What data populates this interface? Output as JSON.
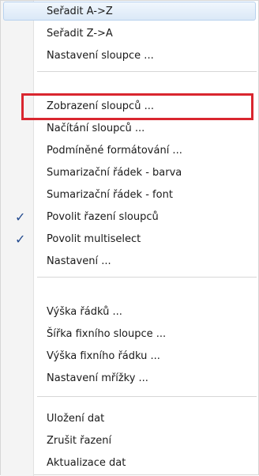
{
  "menu": {
    "items": [
      {
        "label": "Seřadit A->Z",
        "checked": false
      },
      {
        "label": "Seřadit Z->A",
        "checked": false
      },
      {
        "label": "Nastavení sloupce ...",
        "checked": false
      },
      {
        "label": "Zobrazení sloupců ...",
        "checked": false
      },
      {
        "label": "Načítání sloupců ...",
        "checked": false
      },
      {
        "label": "Podmíněné formátování ...",
        "checked": false
      },
      {
        "label": "Sumarizační řádek - barva",
        "checked": false
      },
      {
        "label": "Sumarizační řádek - font",
        "checked": false
      },
      {
        "label": "Povolit řazení sloupců",
        "checked": true
      },
      {
        "label": "Povolit multiselect",
        "checked": true
      },
      {
        "label": "Nastavení ...",
        "checked": false
      },
      {
        "label": "Výška řádků ...",
        "checked": false
      },
      {
        "label": "Šířka fixního sloupce ...",
        "checked": false
      },
      {
        "label": "Výška fixního řádku ...",
        "checked": false
      },
      {
        "label": "Nastavení mřížky ...",
        "checked": false
      },
      {
        "label": "Uložení dat",
        "checked": false
      },
      {
        "label": "Zrušit řazení",
        "checked": false
      },
      {
        "label": "Aktualizace dat",
        "checked": false
      }
    ],
    "check_glyph": "✓",
    "hovered_index": 0,
    "highlighted_index": 3,
    "highlight_color": "#d9262f",
    "check_color": "#244b8f"
  }
}
